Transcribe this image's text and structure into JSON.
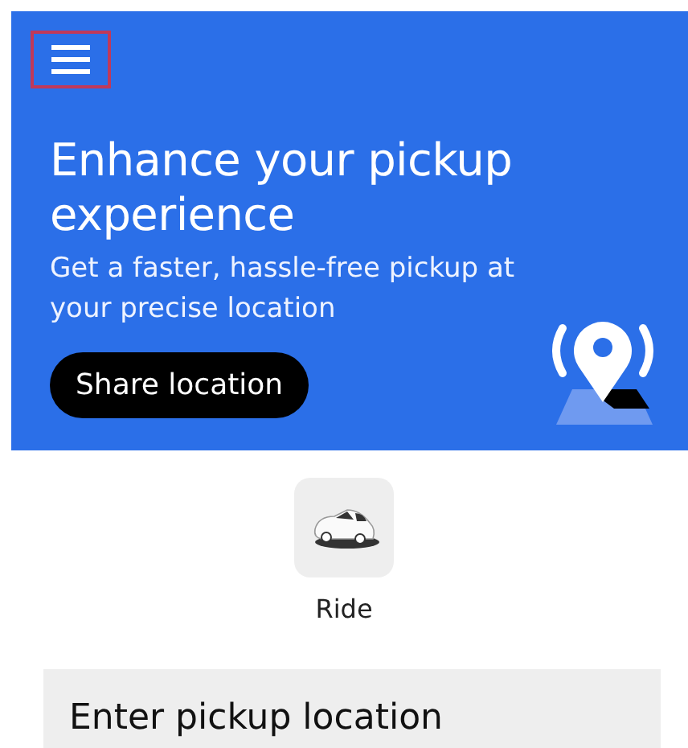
{
  "banner": {
    "menu": {
      "highlighted": true
    },
    "title": "Enhance your pickup experience",
    "subtitle": "Get a faster, hassle-free pickup at your precise location",
    "button": "Share location"
  },
  "services": [
    {
      "label": "Ride"
    }
  ],
  "pickup": {
    "placeholder": "Enter pickup location"
  }
}
